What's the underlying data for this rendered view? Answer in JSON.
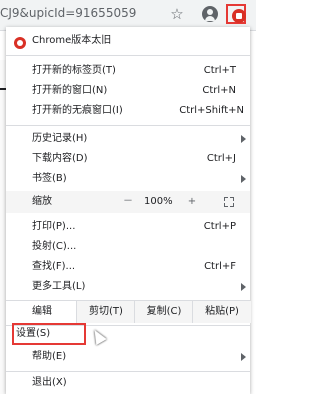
{
  "address_bar": {
    "url_fragment": "CJ9&upicId=91655059"
  },
  "toolbar_icons": [
    "star-icon",
    "account-icon",
    "extension-icon"
  ],
  "menu": {
    "banner": "Chrome版本太旧",
    "new_tab": {
      "label": "打开新的标签页(T)",
      "shortcut": "Ctrl+T"
    },
    "new_window": {
      "label": "打开新的窗口(N)",
      "shortcut": "Ctrl+N"
    },
    "incognito": {
      "label": "打开新的无痕窗口(I)",
      "shortcut": "Ctrl+Shift+N"
    },
    "history": {
      "label": "历史记录(H)"
    },
    "downloads": {
      "label": "下载内容(D)",
      "shortcut": "Ctrl+J"
    },
    "bookmarks": {
      "label": "书签(B)"
    },
    "zoom": {
      "label": "缩放",
      "minus": "－",
      "value": "100%",
      "plus": "+"
    },
    "print": {
      "label": "打印(P)...",
      "shortcut": "Ctrl+P"
    },
    "cast": {
      "label": "投射(C)..."
    },
    "find": {
      "label": "查找(F)...",
      "shortcut": "Ctrl+F"
    },
    "more_tools": {
      "label": "更多工具(L)"
    },
    "edit": {
      "label": "编辑",
      "cut": "剪切(T)",
      "copy": "复制(C)",
      "paste": "粘贴(P)"
    },
    "settings": {
      "label": "设置(S)"
    },
    "help": {
      "label": "帮助(E)"
    },
    "exit": {
      "label": "退出(X)"
    }
  },
  "colors": {
    "highlight": "#e53935",
    "accent_red": "#d93025"
  }
}
